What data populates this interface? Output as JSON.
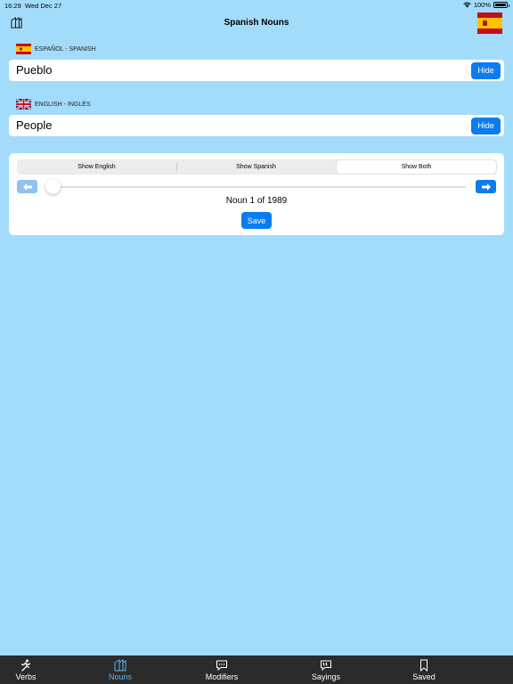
{
  "status": {
    "time": "16:29",
    "date": "Wed Dec 27",
    "battery": "100%"
  },
  "nav": {
    "title": "Spanish Nouns",
    "left_icon": "nouns-icon",
    "right_icon": "spain-flag-icon"
  },
  "spanish": {
    "label": "ESPAÑOL - SPANISH",
    "word": "Pueblo",
    "hide_label": "Hide"
  },
  "english": {
    "label": "ENGLISH - INGLÉS",
    "word": "People",
    "hide_label": "Hide"
  },
  "controls": {
    "segments": [
      "Show English",
      "Show Spanish",
      "Show Both"
    ],
    "selected_segment": "Show Both",
    "counter": "Noun 1 of 1989",
    "slider_value": 1,
    "slider_max": 1989,
    "save_label": "Save"
  },
  "tabs": [
    {
      "label": "Verbs",
      "icon": "runner-icon"
    },
    {
      "label": "Nouns",
      "icon": "nouns-icon",
      "active": true
    },
    {
      "label": "Modifiers",
      "icon": "chat-bubble-icon"
    },
    {
      "label": "Sayings",
      "icon": "quote-bubble-icon"
    },
    {
      "label": "Saved",
      "icon": "bookmark-icon"
    }
  ],
  "colors": {
    "background": "#a3dcfb",
    "accent": "#0a7cf0",
    "tab_bar": "#2b2b2b",
    "tab_active": "#5bb3f5"
  }
}
